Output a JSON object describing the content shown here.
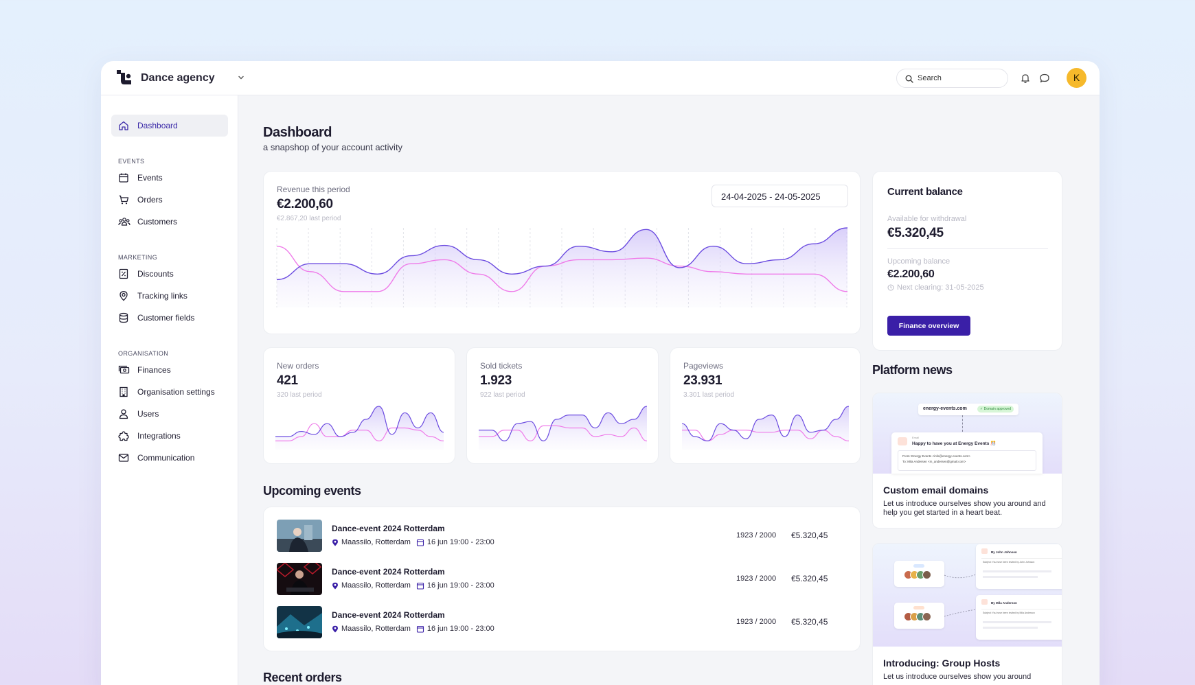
{
  "header": {
    "org_name": "Dance agency",
    "search_placeholder": "Search",
    "avatar_initial": "K"
  },
  "sidebar": {
    "dashboard": "Dashboard",
    "sections": {
      "events": "EVENTS",
      "marketing": "MARKETING",
      "organisation": "ORGANISATION"
    },
    "items": {
      "events": "Events",
      "orders": "Orders",
      "customers": "Customers",
      "discounts": "Discounts",
      "tracking_links": "Tracking links",
      "customer_fields": "Customer fields",
      "finances": "Finances",
      "organisation_settings": "Organisation settings",
      "users": "Users",
      "integrations": "Integrations",
      "communication": "Communication"
    }
  },
  "page": {
    "title": "Dashboard",
    "subtitle": "a snapshop of your account activity"
  },
  "revenue": {
    "label": "Revenue this period",
    "value": "€2.200,60",
    "last": "€2.867,20 last period",
    "date_range": "24-04-2025 - 24-05-2025",
    "chart_current": [
      0.35,
      0.55,
      0.55,
      0.42,
      0.65,
      0.78,
      0.6,
      0.42,
      0.52,
      0.77,
      0.7,
      0.98,
      0.5,
      0.77,
      0.55,
      0.6,
      0.8,
      1.0
    ],
    "chart_last": [
      0.77,
      0.45,
      0.2,
      0.2,
      0.55,
      0.6,
      0.42,
      0.2,
      0.52,
      0.6,
      0.6,
      0.62,
      0.52,
      0.45,
      0.42,
      0.42,
      0.42,
      0.2
    ]
  },
  "stats": [
    {
      "label": "New orders",
      "value": "421",
      "last": "320 last period",
      "current": [
        0.3,
        0.3,
        0.42,
        0.35,
        0.6,
        0.3,
        0.4,
        0.7,
        1.0,
        0.35,
        0.85,
        0.5,
        0.85,
        0.4
      ],
      "previous": [
        0.2,
        0.2,
        0.3,
        0.6,
        0.3,
        0.3,
        0.45,
        0.45,
        0.2,
        0.5,
        0.5,
        0.45,
        0.3,
        0.2
      ]
    },
    {
      "label": "Sold tickets",
      "value": "1.923",
      "last": "922 last period",
      "current": [
        0.45,
        0.45,
        0.2,
        0.6,
        0.65,
        0.2,
        0.7,
        0.8,
        0.8,
        0.5,
        0.85,
        0.6,
        0.7,
        1.0
      ],
      "previous": [
        0.3,
        0.3,
        0.45,
        0.45,
        0.2,
        0.55,
        0.55,
        0.5,
        0.5,
        0.3,
        0.35,
        0.3,
        0.5,
        0.2
      ]
    },
    {
      "label": "Pageviews",
      "value": "23.931",
      "last": "3.301 last period",
      "current": [
        0.6,
        0.3,
        0.2,
        0.6,
        0.45,
        0.25,
        0.7,
        0.8,
        0.3,
        0.8,
        0.4,
        0.45,
        0.7,
        1.0
      ],
      "previous": [
        0.45,
        0.45,
        0.2,
        0.35,
        0.45,
        0.45,
        0.4,
        0.4,
        0.45,
        0.45,
        0.25,
        0.45,
        0.3,
        0.2
      ]
    }
  ],
  "upcoming": {
    "title": "Upcoming events",
    "events": [
      {
        "name": "Dance-event 2024 Rotterdam",
        "location": "Maassilo, Rotterdam",
        "date": "16 jun 19:00 - 23:00",
        "tickets": "1923 / 2000",
        "revenue": "€5.320,45"
      },
      {
        "name": "Dance-event 2024 Rotterdam",
        "location": "Maassilo, Rotterdam",
        "date": "16 jun 19:00 - 23:00",
        "tickets": "1923 / 2000",
        "revenue": "€5.320,45"
      },
      {
        "name": "Dance-event 2024 Rotterdam",
        "location": "Maassilo, Rotterdam",
        "date": "16 jun 19:00 - 23:00",
        "tickets": "1923 / 2000",
        "revenue": "€5.320,45"
      }
    ]
  },
  "recent_orders": {
    "title": "Recent orders"
  },
  "balance": {
    "title": "Current balance",
    "available_label": "Available for withdrawal",
    "available_value": "€5.320,45",
    "upcoming_label": "Upcoming balance",
    "upcoming_value": "€2.200,60",
    "next_clearing": "Next clearing: 31-05-2025",
    "button": "Finance overview"
  },
  "news": {
    "title": "Platform news",
    "items": [
      {
        "title": "Custom email domains",
        "desc": "Let us introduce ourselves show you around and help you get started in a heart beat.",
        "preview": {
          "domain": "energy-events.com",
          "badge": "✓ Domain approved",
          "from_label": "Email",
          "subject": "Happy to have you at Energy Events 🎊",
          "from": "From: Energy Events <info@energy-events.com>",
          "to": "To: Mila Andersen <m_andersen@gmail.com>"
        }
      },
      {
        "title": "Introducing: Group Hosts",
        "desc": "Let us introduce ourselves show you around",
        "preview": {
          "host1": "By John Johnson",
          "host2": "By Mila Anderson",
          "note1": "Subject: You have been invited by John Johnson",
          "note2": "Subject: You have been invited by Mila Anderson"
        }
      }
    ]
  },
  "colors": {
    "accent": "#3a1fa7",
    "series_current": "#6b4be0",
    "series_last": "#ef7be9",
    "avatar": "#f6b92b"
  }
}
